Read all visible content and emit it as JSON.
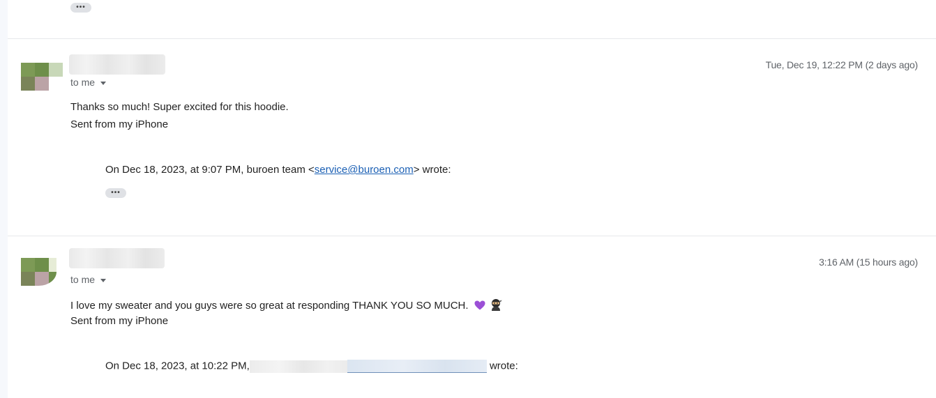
{
  "top": {
    "ellipsis_label": "•••"
  },
  "messages": [
    {
      "to_label": "to me",
      "date": "Tue, Dec 19, 12:22 PM (2 days ago)",
      "body": [
        "Thanks so much! Super excited for this hoodie.",
        "Sent from my iPhone"
      ],
      "quote_prefix": "On Dec 18, 2023, at 9:07 PM, buroen team <",
      "quote_link": "service@buroen.com",
      "quote_suffix": "> wrote:",
      "ellipsis_label": "•••"
    },
    {
      "to_label": "to me",
      "date": "3:16 AM (15 hours ago)",
      "body": [
        "I love my sweater and you guys were so great at responding THANK YOU SO MUCH.",
        "Sent from my iPhone"
      ],
      "quote_prefix": "On Dec 18, 2023, at 10:22 PM,",
      "quote_suffix": " wrote:"
    }
  ],
  "icons": {
    "heart": "purple-heart-icon",
    "ninja": "ninja-icon",
    "caret": "caret-down-icon"
  },
  "colors": {
    "link": "#1a5fb4",
    "heart": "#9b4fd6",
    "muted": "#5f6368"
  }
}
